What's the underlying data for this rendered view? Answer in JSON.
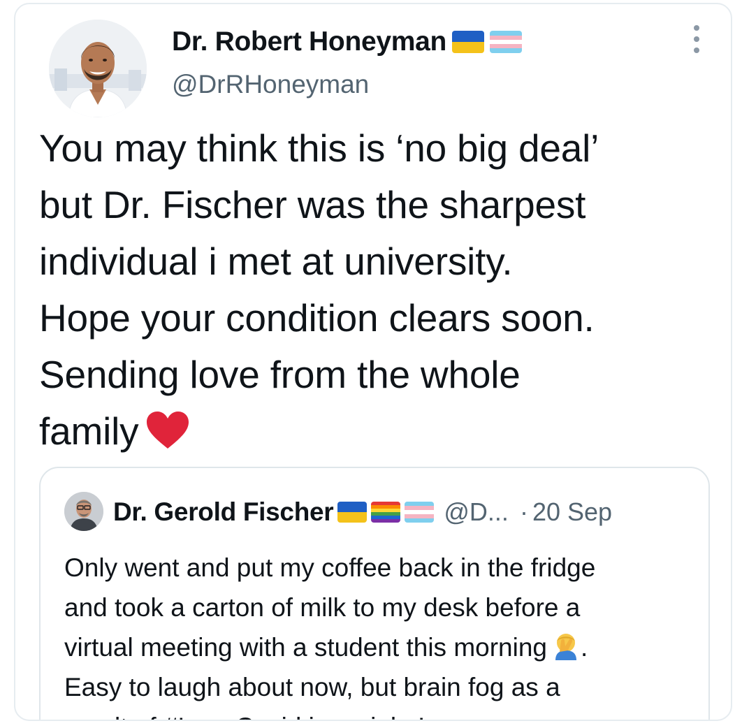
{
  "tweet": {
    "author": {
      "name": "Dr. Robert Honeyman",
      "handle": "@DrRHoneyman",
      "flags": [
        "ukraine-flag",
        "trans-flag"
      ],
      "avatar": "avatar-photo"
    },
    "more_icon": "more-dots-icon",
    "text_lines": [
      "You may think this is ‘no big deal’",
      "but Dr. Fischer was the sharpest",
      "individual i met at university.",
      "Hope your condition clears soon.",
      "Sending love from the whole",
      "family"
    ],
    "text_emoji": "red-heart-icon"
  },
  "quote": {
    "author": {
      "name": "Dr. Gerold Fischer",
      "handle": "@D...",
      "flags": [
        "ukraine-flag",
        "rainbow-flag",
        "trans-flag"
      ],
      "avatar": "avatar-photo"
    },
    "separator": "·",
    "date": "20 Sep",
    "text_lines": [
      "Only went and put my coffee back in the fridge",
      "and took a carton of milk to my desk before a",
      "virtual meeting with a student this morning",
      "Easy to laugh about now, but brain fog as a",
      "result of #LongCovid is no joke!"
    ],
    "line3_suffix": ".",
    "line3_emoji": "facepalm-icon"
  },
  "colors": {
    "text": "#0f1419",
    "secondary": "#536471",
    "border": "#e6ecf0",
    "heart": "#e0243a"
  }
}
